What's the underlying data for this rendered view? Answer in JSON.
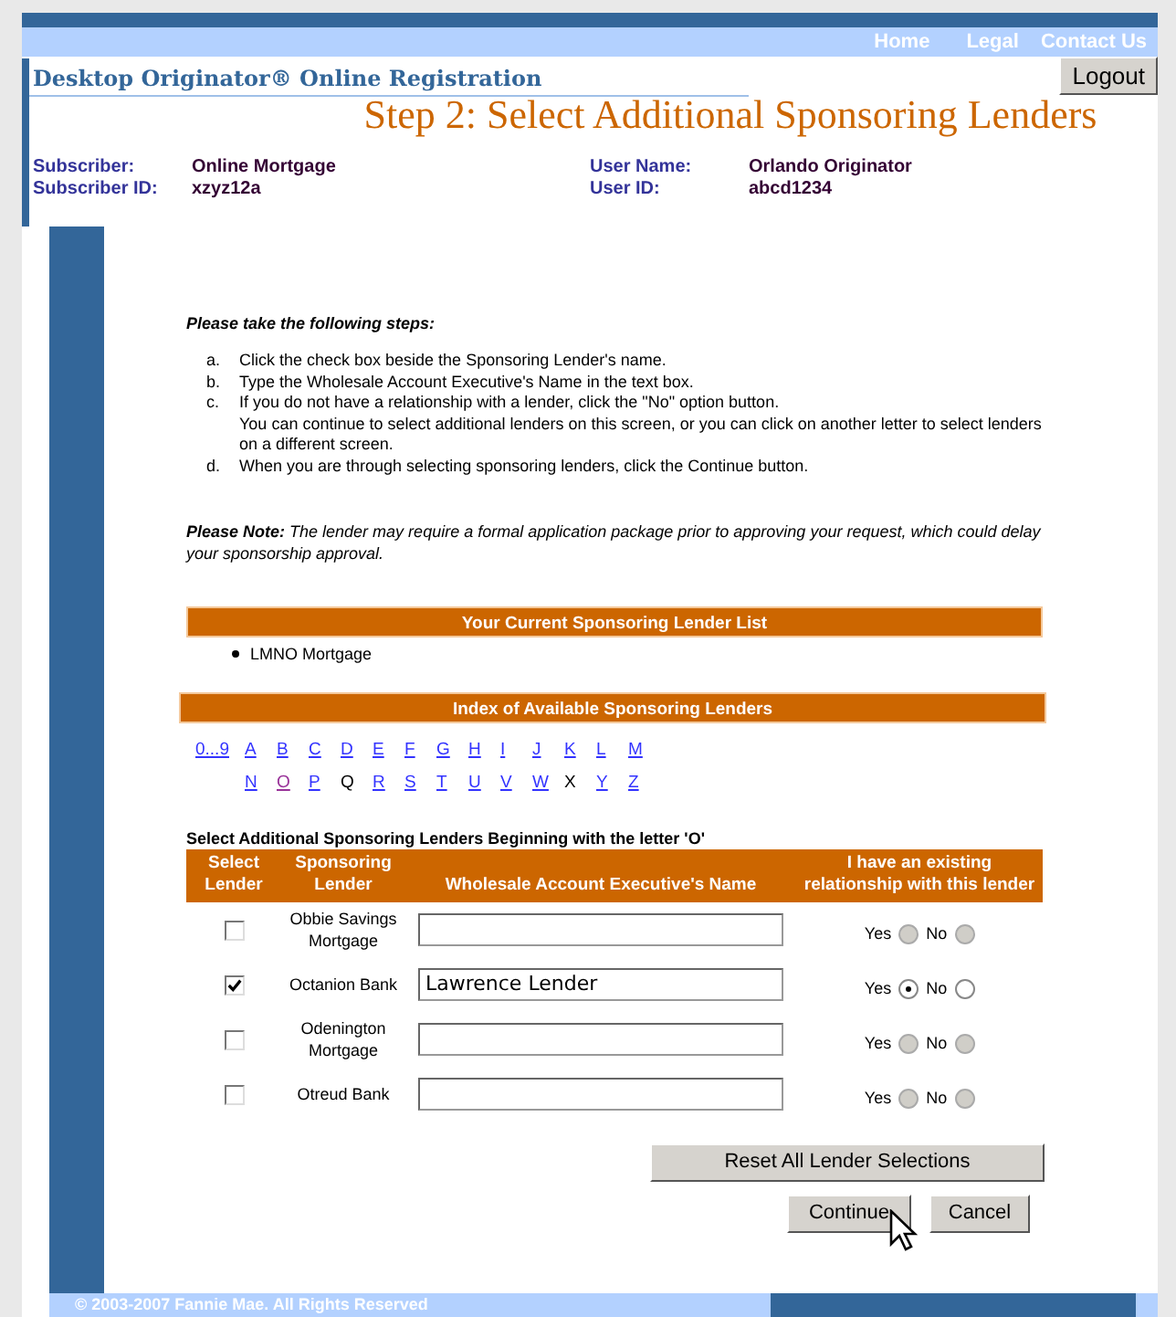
{
  "nav": {
    "links": [
      "Home",
      "Legal",
      "Contact Us"
    ]
  },
  "header": {
    "app_title": "Desktop Originator® Online Registration",
    "logout": "Logout",
    "step_title": "Step 2: Select Additional Sponsoring Lenders"
  },
  "user_info": [
    {
      "label": "Subscriber:",
      "value": "Online Mortgage"
    },
    {
      "label": "User Name:",
      "value": "Orlando Originator"
    },
    {
      "label": "Subscriber ID:",
      "value": "xzyz12a"
    },
    {
      "label": "User ID:",
      "value": "abcd1234"
    }
  ],
  "instructions": {
    "heading": "Please take the following steps:",
    "steps": [
      {
        "marker": "a.",
        "text": "Click the check box beside the Sponsoring Lender's name."
      },
      {
        "marker": "b.",
        "text": "Type the Wholesale Account Executive's Name in the text box."
      },
      {
        "marker": "c.",
        "text": "If you do not have a relationship with a lender, click the \"No\" option button."
      },
      {
        "text": "You can continue to select additional lenders on this screen, or you can click on another letter to select lenders on a different screen."
      },
      {
        "marker": "d.",
        "text": "When you are through selecting sponsoring lenders, click the Continue button."
      }
    ],
    "note": "**Please Note:** The lender may require a formal application package prior to approving your request, which could delay your sponsorship approval."
  },
  "current_lenders": {
    "title": "Your Current Sponsoring Lender List",
    "items": [
      "LMNO Mortgage"
    ]
  },
  "index": {
    "title": "Index of Available Sponsoring Lenders",
    "rows": [
      [
        {
          "label": "0...9",
          "kind": "link"
        },
        {
          "label": "A",
          "kind": "link"
        },
        {
          "label": "B",
          "kind": "link"
        },
        {
          "label": "C",
          "kind": "link"
        },
        {
          "label": "D",
          "kind": "link"
        },
        {
          "label": "E",
          "kind": "link"
        },
        {
          "label": "F",
          "kind": "link"
        },
        {
          "label": "G",
          "kind": "link"
        },
        {
          "label": "H",
          "kind": "link"
        },
        {
          "label": "I",
          "kind": "link"
        },
        {
          "label": "J",
          "kind": "link"
        },
        {
          "label": "K",
          "kind": "link"
        },
        {
          "label": "L",
          "kind": "link"
        },
        {
          "label": "M",
          "kind": "link"
        }
      ],
      [
        "",
        {
          "label": "N",
          "kind": "link"
        },
        {
          "label": "O",
          "kind": "visited"
        },
        {
          "label": "P",
          "kind": "link"
        },
        {
          "label": "Q",
          "kind": "plain"
        },
        {
          "label": "R",
          "kind": "link"
        },
        {
          "label": "S",
          "kind": "link"
        },
        {
          "label": "T",
          "kind": "link"
        },
        {
          "label": "U",
          "kind": "link"
        },
        {
          "label": "V",
          "kind": "link"
        },
        {
          "label": "W",
          "kind": "link"
        },
        {
          "label": "X",
          "kind": "plain"
        },
        {
          "label": "Y",
          "kind": "link"
        },
        {
          "label": "Z",
          "kind": "link"
        }
      ]
    ]
  },
  "table": {
    "caption": "Select Additional Sponsoring Lenders Beginning with the letter 'O'",
    "columns": [
      "Select Lender",
      "Sponsoring Lender",
      "Wholesale Account Executive's Name",
      "I have an existing relationship with this lender"
    ],
    "rows": [
      {
        "checked": false,
        "lender": "Obbie Savings Mortgage",
        "executive": "",
        "yes_label": "Yes",
        "no_label": "No",
        "yes_selected": false,
        "no_selected": false,
        "radios_disabled": true
      },
      {
        "checked": true,
        "lender": "Octanion Bank",
        "executive": "Lawrence Lender",
        "yes_label": "Yes",
        "no_label": "No",
        "yes_selected": true,
        "no_selected": false,
        "radios_disabled": false
      },
      {
        "checked": false,
        "lender": "Odenington Mortgage",
        "executive": "",
        "yes_label": "Yes",
        "no_label": "No",
        "yes_selected": false,
        "no_selected": false,
        "radios_disabled": true
      },
      {
        "checked": false,
        "lender": "Otreud Bank",
        "executive": "",
        "yes_label": "Yes",
        "no_label": "No",
        "yes_selected": false,
        "no_selected": false,
        "radios_disabled": true
      }
    ]
  },
  "buttons": {
    "reset": "Reset All Lender Selections",
    "continue": "Continue",
    "cancel": "Cancel"
  },
  "footer": {
    "copyright": "© 2003-2007 Fannie Mae. All Rights Reserved"
  }
}
